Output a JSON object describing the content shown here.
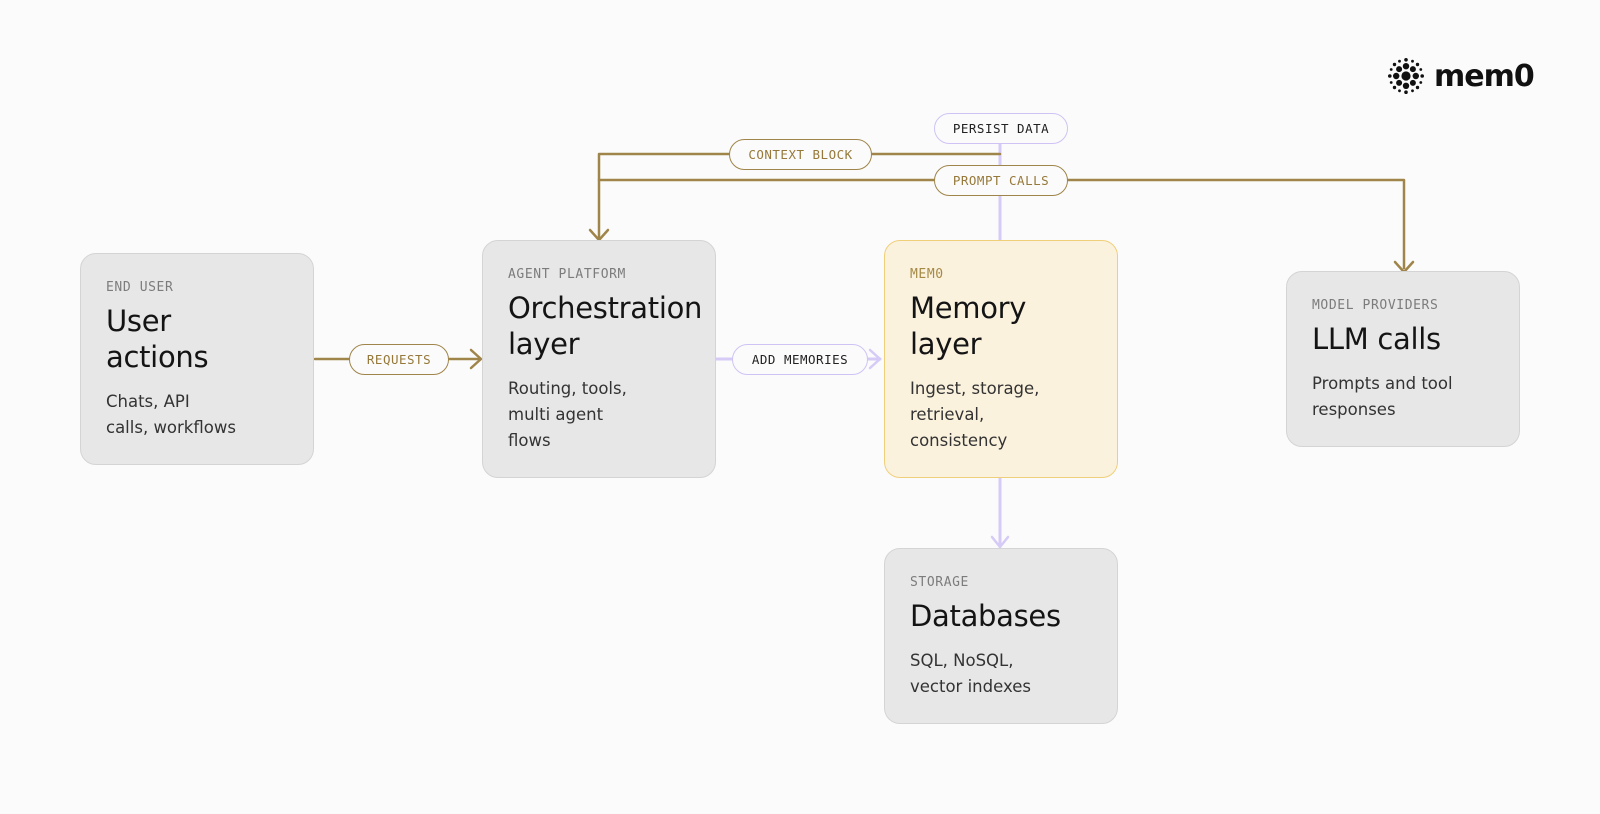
{
  "logo": {
    "text": "mem0",
    "icon": "mem0-flower-icon"
  },
  "nodes": {
    "end_user": {
      "kicker": "END USER",
      "title": "User\nactions",
      "desc": "Chats, API\ncalls, workflows"
    },
    "agent": {
      "kicker": "AGENT PLATFORM",
      "title": "Orchestration\nlayer",
      "desc": "Routing, tools,\nmulti agent\nflows"
    },
    "memory": {
      "kicker": "MEM0",
      "title": "Memory\nlayer",
      "desc": "Ingest, storage,\nretrieval,\nconsistency"
    },
    "llm": {
      "kicker": "MODEL PROVIDERS",
      "title": "LLM calls",
      "desc": "Prompts and tool\nresponses"
    },
    "storage": {
      "kicker": "STORAGE",
      "title": "Databases",
      "desc": "SQL, NoSQL,\nvector indexes"
    }
  },
  "edges": {
    "requests": "REQUESTS",
    "add_memories": "ADD MEMORIES",
    "persist_data": "PERSIST DATA",
    "context_block": "CONTEXT BLOCK",
    "prompt_calls": "PROMPT CALLS"
  },
  "colors": {
    "background": "#fbfbfb",
    "node_fill": "#e7e7e7",
    "accent_fill": "#fbf2de",
    "accent_border": "#f0cf7a",
    "gold_line": "#a0854a",
    "lavender_line": "#d6cbf7"
  }
}
